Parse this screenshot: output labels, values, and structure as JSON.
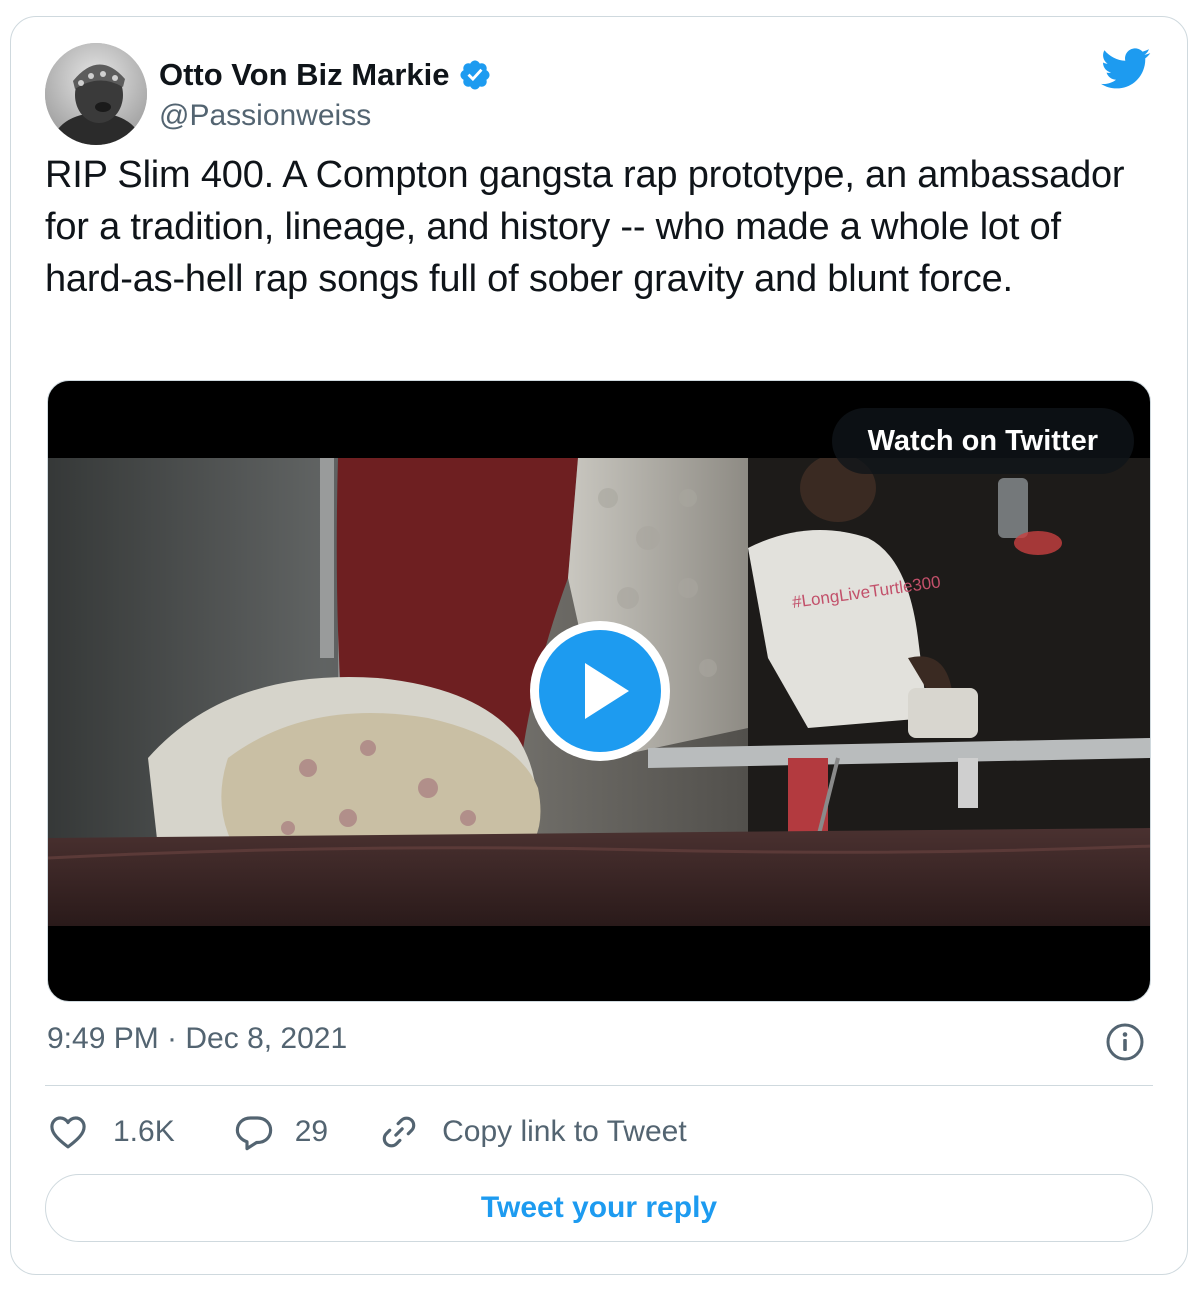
{
  "author": {
    "display_name": "Otto Von Biz Markie",
    "handle": "@Passionweiss",
    "verified": true,
    "avatar_icon": "profile-photo"
  },
  "tweet": {
    "text": "RIP Slim 400. A Compton gangsta rap prototype, an ambassador for a tradition, lineage, and history -- who made a whole lot of hard-as-hell rap songs full of sober gravity and blunt force.",
    "timestamp": "9:49 PM · Dec 8, 2021"
  },
  "media": {
    "type": "video",
    "watch_label": "Watch on Twitter",
    "shirt_text": "#LongLiveTurtle300",
    "play_icon": "play-icon"
  },
  "actions": {
    "like_count": "1.6K",
    "reply_count": "29",
    "copy_link_label": "Copy link to Tweet"
  },
  "reply_prompt": "Tweet your reply",
  "colors": {
    "accent": "#1d9bf0",
    "text_primary": "#0f1419",
    "text_secondary": "#536471",
    "border": "#cfd9de",
    "verified": "#1d9bf0"
  }
}
